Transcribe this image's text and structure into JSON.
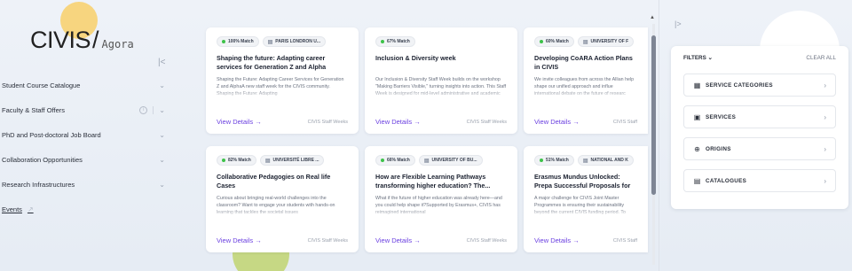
{
  "brand": {
    "name": "CIVIS",
    "slash": "/",
    "sub": "Agora"
  },
  "sidebar": {
    "items": [
      {
        "label": "Student Course Catalogue"
      },
      {
        "label": "Faculty & Staff Offers"
      },
      {
        "label": "PhD and Post-doctoral Job Board"
      },
      {
        "label": "Collaboration Opportunities"
      },
      {
        "label": "Research Infrastructures"
      }
    ],
    "events_label": "Events"
  },
  "cards": [
    {
      "match": "100% Match",
      "uni": "PARIS LONDRON U...",
      "title": "Shaping the future: Adapting career services for Generation Z and Alpha",
      "desc": "Shaping the Future: Adapting Career Services for Generation Z and AlphaA new staff week for the CIVIS community. Shaping the Future: Adapting",
      "link": "View Details →",
      "source": "CIVIS Staff Weeks"
    },
    {
      "match": "67% Match",
      "uni": "",
      "title": "Inclusion & Diversity week",
      "desc": "Our Inclusion & Diversity Staff Week builds on the workshop \"Making Barriers Visible,\" turning insights into action. This Staff Week is designed for mid-level administrative and academic staff and",
      "link": "View Details →",
      "source": "CIVIS Staff Weeks"
    },
    {
      "match": "60% Match",
      "uni": "UNIVERSITY OF F",
      "title": "Developing CoARA Action Plans in CIVIS",
      "desc": "We invite colleagues from across the Allian help shape our unified approach and influe international debate on the future of researc",
      "link": "View Details →",
      "source": "CIVIS Staff"
    },
    {
      "match": "82% Match",
      "uni": "UNIVERSITÉ LIBRE ...",
      "title": "Collaborative Pedagogies on Real life Cases",
      "desc": "Curious about bringing real-world challenges into the classroom? Want to engage your students with hands-on learning that tackles the societal issues",
      "link": "View Details →",
      "source": "CIVIS Staff Weeks"
    },
    {
      "match": "66% Match",
      "uni": "UNIVERSITY OF BU...",
      "title": "How are Flexible Learning Pathways transforming higher education? The...",
      "desc": "What if the future of higher education was already here—and you could help shape it?Supported by Erasmus+, CIVIS has reimagined international",
      "link": "View Details →",
      "source": "CIVIS Staff Weeks"
    },
    {
      "match": "51% Match",
      "uni": "NATIONAL AND K",
      "title": "Erasmus Mundus Unlocked: Prepa Successful Proposals for Sustaina",
      "desc": "A major challenge for CIVIS Joint Master Programmes is ensuring their sustainability beyond the current CIVIS funding period. To",
      "link": "View Details →",
      "source": "CIVIS Staff"
    }
  ],
  "filters": {
    "title": "FILTERS",
    "clear": "CLEAR ALL",
    "items": [
      {
        "label": "SERVICE CATEGORIES",
        "icon": "grid-icon"
      },
      {
        "label": "SERVICES",
        "icon": "briefcase-icon"
      },
      {
        "label": "ORIGINS",
        "icon": "globe-icon"
      },
      {
        "label": "CATALOGUES",
        "icon": "document-icon"
      }
    ]
  },
  "colors": {
    "accent": "#6a3fe0",
    "match_dot": "#3ec24a",
    "background": "#eef2f8"
  }
}
